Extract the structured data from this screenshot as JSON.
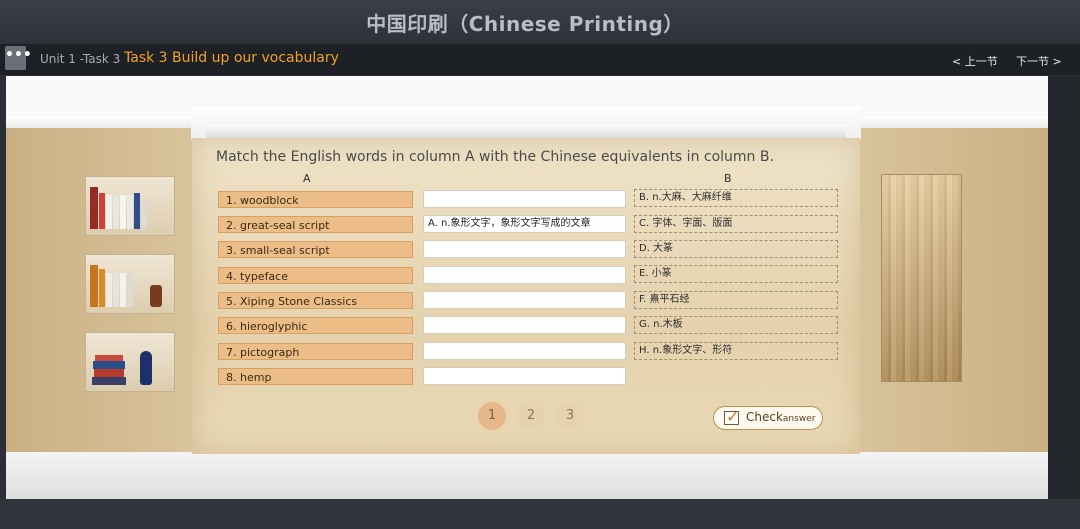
{
  "app": {
    "title": "中国印刷（Chinese Printing）"
  },
  "navbar": {
    "menu_icon": "•••",
    "unit": "Unit 1 -Task 3",
    "task_title": "Task 3 Build up our vocabulary",
    "prev": "< 上一节",
    "next": "下一节 >"
  },
  "exercise": {
    "instruction": "Match the English words in column A with the Chinese equivalents in column B.",
    "col_a": "A",
    "col_b": "B",
    "words": [
      "1. woodblock",
      "2. great-seal script",
      "3. small-seal script",
      "4. typeface",
      "5. Xiping Stone Classics",
      "6. hieroglyphic",
      "7. pictograph",
      "8. hemp"
    ],
    "answers": [
      "",
      "A. n.象形文字，象形文字写成的文章",
      "",
      "",
      "",
      "",
      "",
      ""
    ],
    "options": [
      "B. n.大麻、大麻纤维",
      "C. 字体、字面、版面",
      "D. 大篆",
      "E. 小篆",
      "F. 熹平石经",
      "G. n.木板",
      "H. n.象形文字、形符"
    ],
    "pages": [
      "1",
      "2",
      "3"
    ],
    "check": {
      "main": "Check",
      "small": "answer"
    }
  },
  "colors": {
    "accent": "#f0a224",
    "word_bg": "#edbd88",
    "panel_bg": "#e5d2ad"
  }
}
